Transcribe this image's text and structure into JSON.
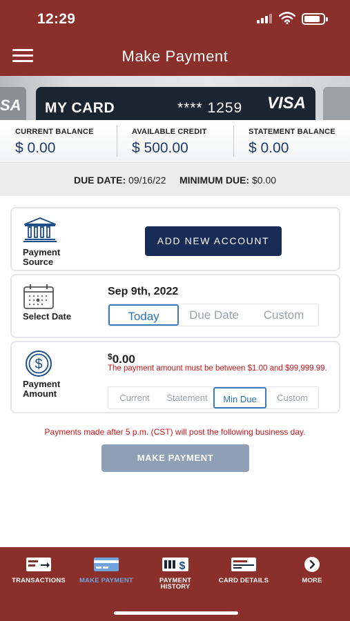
{
  "status_bar": {
    "time": "12:29"
  },
  "header": {
    "title": "Make Payment"
  },
  "cards": {
    "prev_brand": "SA",
    "current_name": "MY CARD",
    "current_number": "**** 1259",
    "current_brand": "VISA"
  },
  "balances": [
    {
      "label": "CURRENT BALANCE",
      "amount": "$ 0.00"
    },
    {
      "label": "AVAILABLE CREDIT",
      "amount": "$ 500.00"
    },
    {
      "label": "STATEMENT BALANCE",
      "amount": "$ 0.00"
    }
  ],
  "due": {
    "due_label": "DUE DATE:",
    "due_value": "09/16/22",
    "min_label": "MINIMUM DUE:",
    "min_value": "$0.00"
  },
  "payment_source": {
    "label_line1": "Payment",
    "label_line2": "Source",
    "button": "ADD NEW ACCOUNT",
    "icon": "bank-icon"
  },
  "select_date": {
    "label": "Select Date",
    "date": "Sep 9th, 2022",
    "options": [
      "Today",
      "Due Date",
      "Custom"
    ],
    "selected": "Today",
    "icon": "calendar-icon"
  },
  "payment_amount": {
    "label_line1": "Payment",
    "label_line2": "Amount",
    "currency": "$",
    "value": "0.00",
    "error": "The payment amount must be between $1.00 and $99,999.99.",
    "options": [
      "Current",
      "Statement",
      "Min Due",
      "Custom"
    ],
    "selected": "Min Due",
    "icon": "dollar-icon"
  },
  "notice": "Payments made after 5 p.m. (CST) will post the following business day.",
  "submit": "MAKE PAYMENT",
  "tabs": [
    {
      "label": "TRANSACTIONS",
      "icon": "transactions-icon"
    },
    {
      "label": "MAKE PAYMENT",
      "icon": "card-icon",
      "active": true
    },
    {
      "label_line1": "PAYMENT",
      "label_line2": "HISTORY",
      "icon": "payment-history-icon"
    },
    {
      "label": "CARD DETAILS",
      "icon": "card-details-icon"
    },
    {
      "label": "MORE",
      "icon": "more-icon"
    }
  ],
  "colors": {
    "brand": "#8b2f2b",
    "primary_button": "#162c57",
    "accent": "#3a7bbd",
    "error": "#c8151b",
    "balance_text": "#1f3a6b"
  }
}
